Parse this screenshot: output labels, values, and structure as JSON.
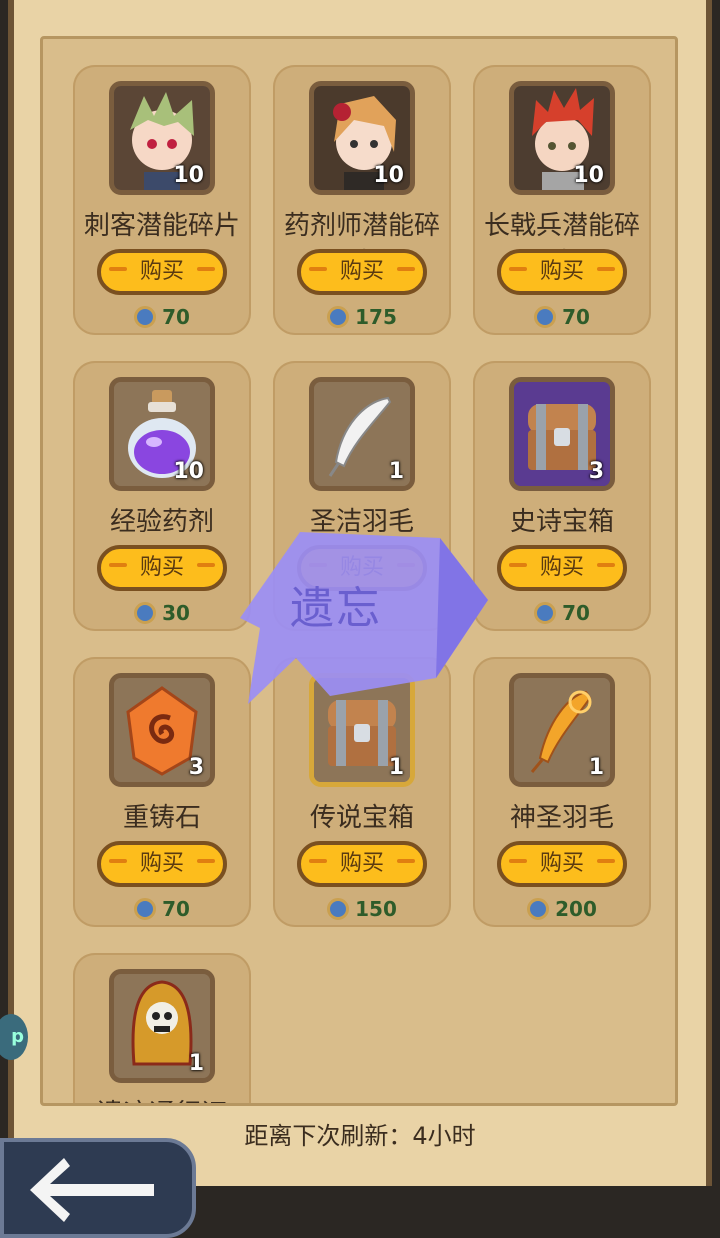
{
  "shop": {
    "items": [
      {
        "name": "刺客潜能碎片",
        "count": "10",
        "buy_label": "购买",
        "price": "70",
        "icon": "assassin-portrait-icon"
      },
      {
        "name": "药剂师潜能碎片",
        "count": "10",
        "buy_label": "购买",
        "price": "175",
        "icon": "alchemist-portrait-icon"
      },
      {
        "name": "长戟兵潜能碎片",
        "count": "10",
        "buy_label": "购买",
        "price": "70",
        "icon": "halberdier-portrait-icon"
      },
      {
        "name": "经验药剂",
        "count": "10",
        "buy_label": "购买",
        "price": "30",
        "icon": "potion-icon"
      },
      {
        "name": "圣洁羽毛",
        "count": "1",
        "buy_label": "购买",
        "price": "",
        "icon": "white-feather-icon"
      },
      {
        "name": "史诗宝箱",
        "count": "3",
        "buy_label": "购买",
        "price": "70",
        "icon": "epic-chest-icon"
      },
      {
        "name": "重铸石",
        "count": "3",
        "buy_label": "购买",
        "price": "70",
        "icon": "reforge-stone-icon"
      },
      {
        "name": "传说宝箱",
        "count": "1",
        "buy_label": "购买",
        "price": "150",
        "icon": "legend-chest-icon"
      },
      {
        "name": "神圣羽毛",
        "count": "1",
        "buy_label": "购买",
        "price": "200",
        "icon": "golden-feather-icon"
      },
      {
        "name": "遗迹通行证",
        "count": "1",
        "icon": "skull-hood-icon"
      }
    ],
    "refresh_text": "距离下次刷新：4小时",
    "overlay_label": "遗忘",
    "side_badge": "p"
  },
  "colors": {
    "button": "#fdbd1c",
    "panel": "#d9bd8b",
    "card": "#ceae7a",
    "text": "#3b2d1f",
    "price": "#2e5c2a",
    "overlay": "#9b8ef5"
  }
}
